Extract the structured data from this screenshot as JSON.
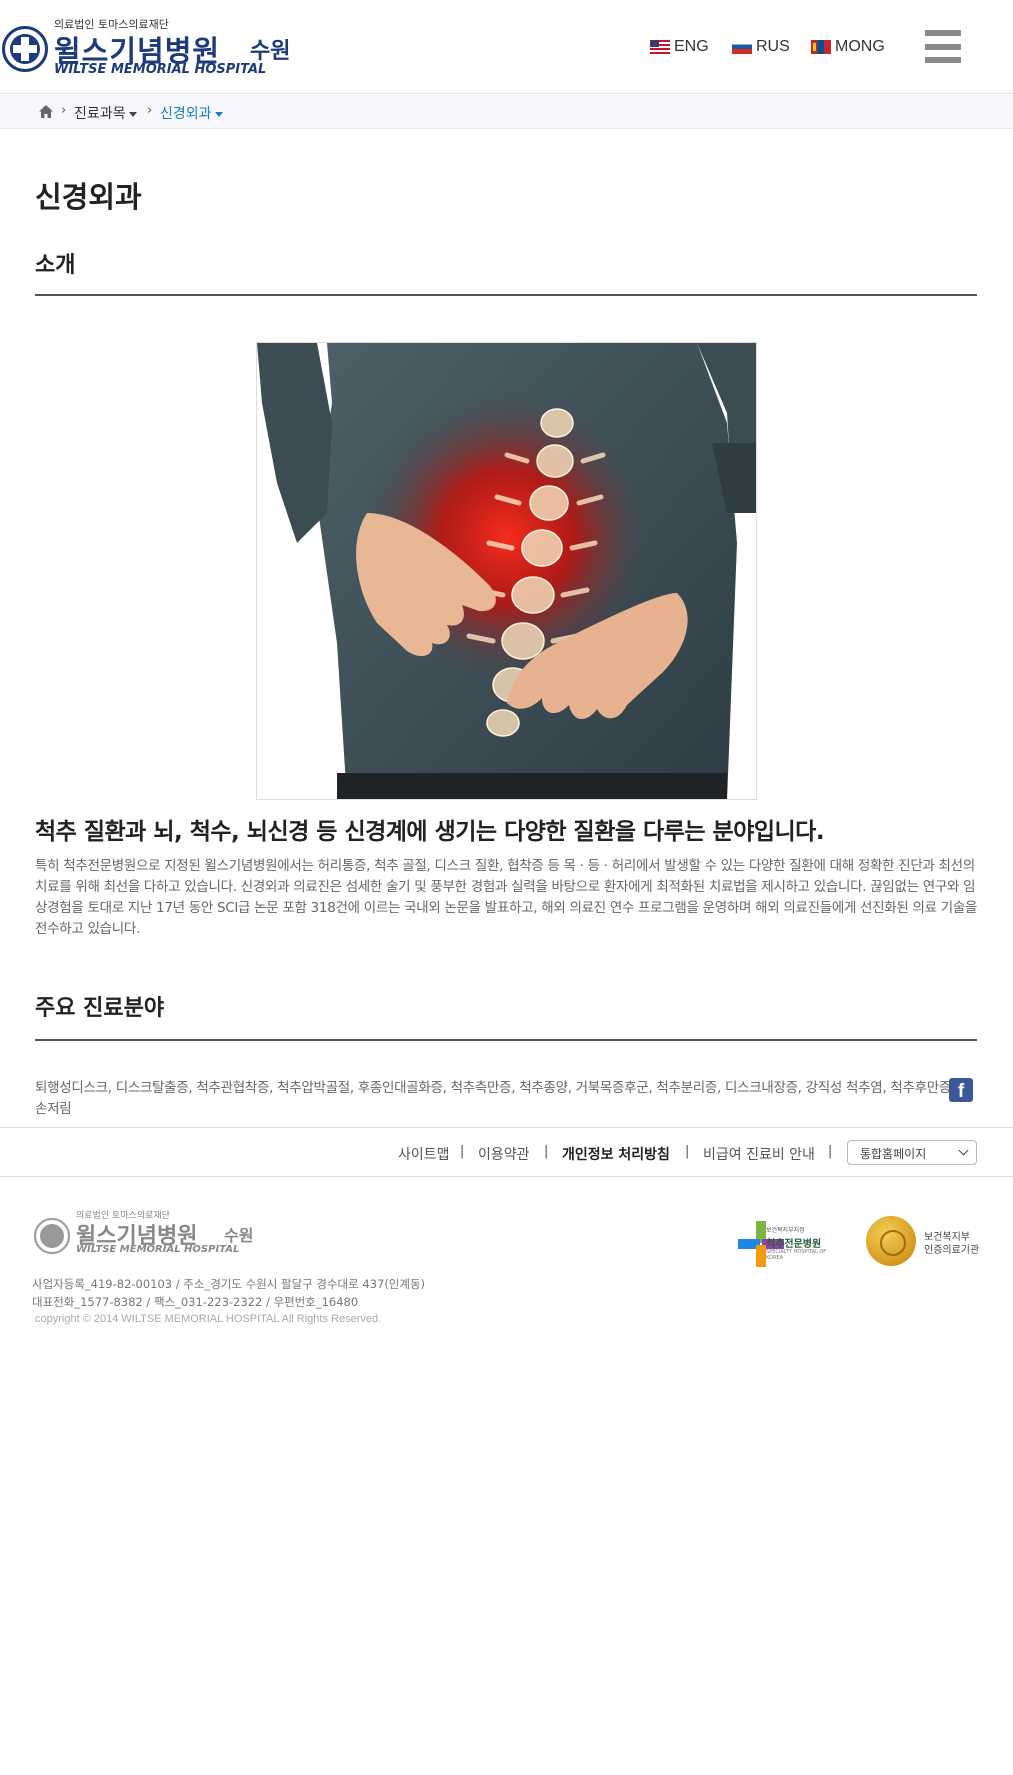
{
  "header": {
    "logo": {
      "sub": "의료법인 토마스의료재단",
      "name_ko": "윌스기념병원",
      "city": "수원",
      "name_en": "WILTSE MEMORIAL HOSPITAL"
    },
    "languages": [
      {
        "label": "ENG",
        "icon": "us-flag-icon"
      },
      {
        "label": "RUS",
        "icon": "ru-flag-icon"
      },
      {
        "label": "MONG",
        "icon": "mn-flag-icon"
      }
    ],
    "menu_icon": "hamburger-menu-icon"
  },
  "breadcrumb": {
    "home_icon": "home-icon",
    "items": [
      {
        "label": "진료과목"
      },
      {
        "label": "신경외과"
      }
    ]
  },
  "main": {
    "page_title": "신경외과",
    "intro": {
      "heading": "소개",
      "lead": "척추 질환과 뇌, 척수, 뇌신경 등 신경계에 생기는 다양한 질환을 다루는 분야입니다.",
      "description": "특히 척추전문병원으로 지정된 윌스기념병원에서는 허리통증, 척추 골절, 디스크 질환, 협착증 등 목 · 등 · 허리에서 발생할 수 있는 다양한 질환에 대해 정확한 진단과 최선의 치료를 위해 최선을 다하고 있습니다. 신경외과 의료진은 섬세한 술기 및 풍부한 경험과 실력을 바탕으로 환자에게 최적화된 치료법을 제시하고 있습니다. 끊임없는 연구와 임상경험을 토대로 지난 17년 동안 SCI급 논문 포함 318건에 이르는 국내외 논문을 발표하고, 해외 의료진 연수 프로그램을 운영하며 해외 의료진들에게 선진화된 의료 기술을 전수하고 있습니다."
    },
    "areas": {
      "heading": "주요 진료분야",
      "text": "퇴행성디스크, 디스크탈출증, 척추관협착증, 척추압박골절, 후종인대골화증, 척추측만증, 척추종양, 거북목증후군, 척추분리증, 디스크내장증, 강직성 척추염, 척추후만증, 손저림"
    },
    "facebook_icon": "facebook-icon"
  },
  "footer": {
    "links": [
      {
        "label": "사이트맵",
        "bold": false
      },
      {
        "label": "이용약관",
        "bold": false
      },
      {
        "label": "개인정보 처리방침",
        "bold": true
      },
      {
        "label": "비급여 진료비 안내",
        "bold": false
      }
    ],
    "family_select": "통합홈페이지",
    "logo": {
      "sub": "의료법인 토마스의료재단",
      "name_ko": "윌스기념병원",
      "city": "수원",
      "name_en": "WILTSE MEMORIAL HOSPITAL"
    },
    "badges": {
      "specialty": {
        "small": "보건복지부지정",
        "big": "척추전문병원",
        "tiny": "SPECIALTY HOSPITAL OF KOREA"
      },
      "certified": {
        "line1": "보건복지부",
        "line2": "인증의료기관"
      }
    },
    "info_line1": "사업자등록_419-82-00103  /  주소_경기도 수원시 팔달구 경수대로 437(인계동)",
    "info_line2": "대표전화_1577-8382  /  팩스_031-223-2322  /  우편번호_16480",
    "copyright": "copyright © 2014 WILTSE MEMORIAL HOSPITAL All Rights Reserved."
  },
  "colors": {
    "brand_navy": "#1d3b7a",
    "breadcrumb_active": "#1b7fc4",
    "facebook": "#3b5998"
  }
}
